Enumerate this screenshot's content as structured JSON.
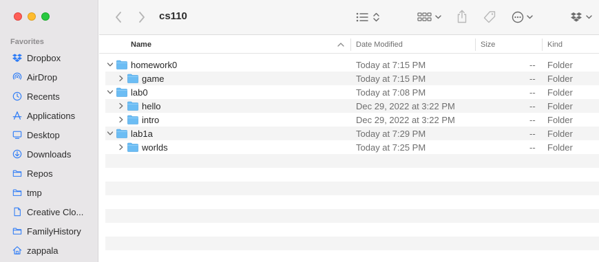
{
  "window": {
    "title": "cs110"
  },
  "sidebar": {
    "section_header": "Favorites",
    "items": [
      {
        "label": "Dropbox",
        "icon": "dropbox-icon"
      },
      {
        "label": "AirDrop",
        "icon": "airdrop-icon"
      },
      {
        "label": "Recents",
        "icon": "clock-icon"
      },
      {
        "label": "Applications",
        "icon": "applications-icon"
      },
      {
        "label": "Desktop",
        "icon": "desktop-icon"
      },
      {
        "label": "Downloads",
        "icon": "downloads-icon"
      },
      {
        "label": "Repos",
        "icon": "folder-icon"
      },
      {
        "label": "tmp",
        "icon": "folder-icon"
      },
      {
        "label": "Creative Clo...",
        "icon": "document-icon"
      },
      {
        "label": "FamilyHistory",
        "icon": "folder-icon"
      },
      {
        "label": "zappala",
        "icon": "home-icon"
      }
    ]
  },
  "columns": {
    "name": "Name",
    "date": "Date Modified",
    "size": "Size",
    "kind": "Kind"
  },
  "files": [
    {
      "name": "homework0",
      "date": "Today at 7:15 PM",
      "size": "--",
      "kind": "Folder",
      "level": 0,
      "expanded": true
    },
    {
      "name": "game",
      "date": "Today at 7:15 PM",
      "size": "--",
      "kind": "Folder",
      "level": 1,
      "expanded": false
    },
    {
      "name": "lab0",
      "date": "Today at 7:08 PM",
      "size": "--",
      "kind": "Folder",
      "level": 0,
      "expanded": true
    },
    {
      "name": "hello",
      "date": "Dec 29, 2022 at 3:22 PM",
      "size": "--",
      "kind": "Folder",
      "level": 1,
      "expanded": false
    },
    {
      "name": "intro",
      "date": "Dec 29, 2022 at 3:22 PM",
      "size": "--",
      "kind": "Folder",
      "level": 1,
      "expanded": false
    },
    {
      "name": "lab1a",
      "date": "Today at 7:29 PM",
      "size": "--",
      "kind": "Folder",
      "level": 0,
      "expanded": true
    },
    {
      "name": "worlds",
      "date": "Today at 7:25 PM",
      "size": "--",
      "kind": "Folder",
      "level": 1,
      "expanded": false
    }
  ],
  "colors": {
    "accent": "#2e7cf6",
    "folder": "#5ab0f0",
    "sidebar_bg": "#e8e6e8"
  }
}
